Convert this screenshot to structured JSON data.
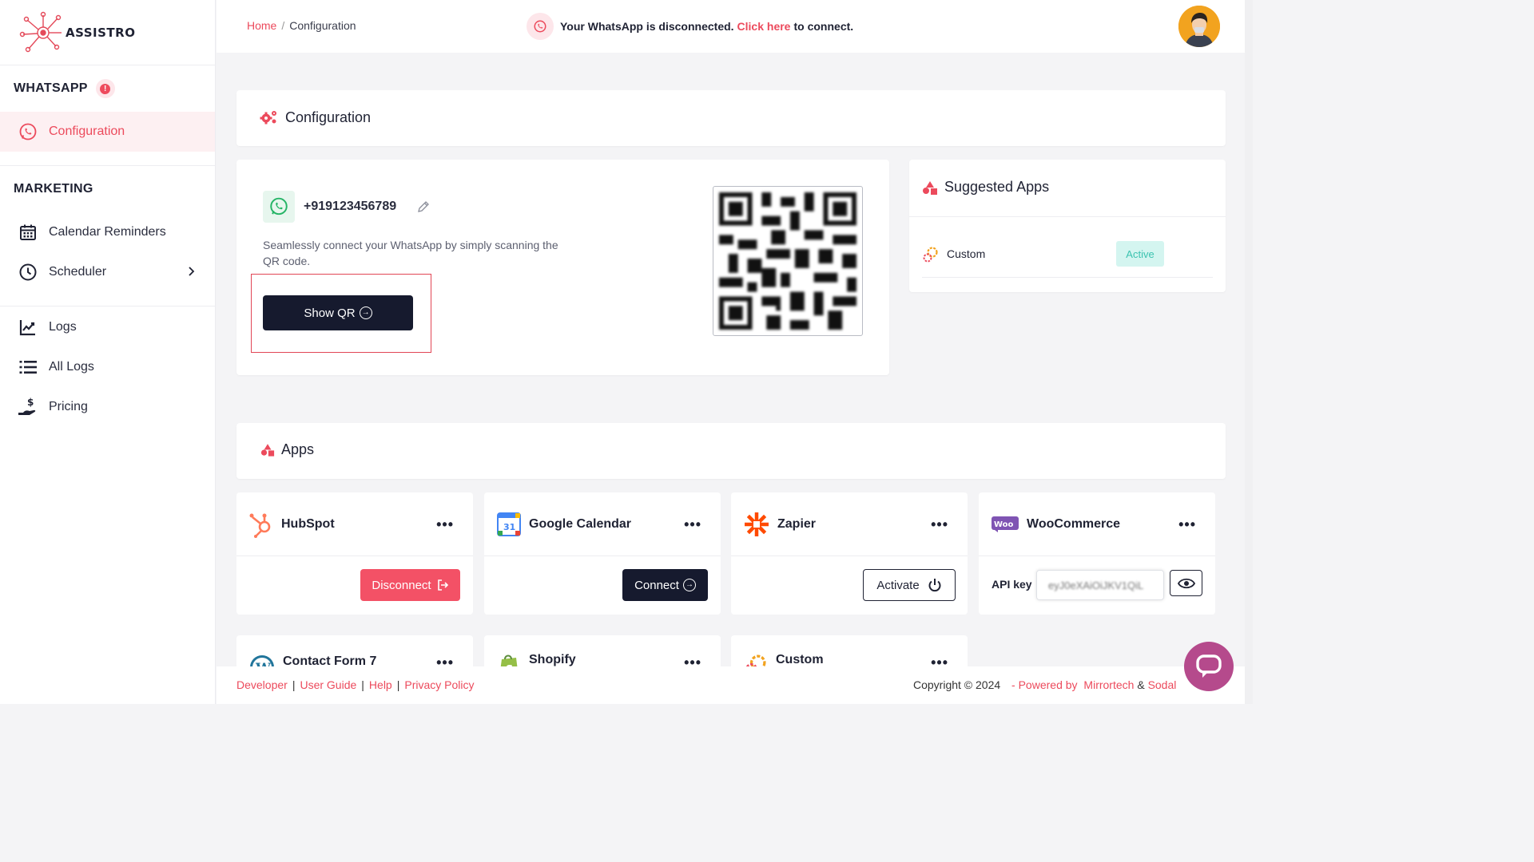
{
  "brand": {
    "name": "ASSISTRO"
  },
  "sidebar": {
    "whatsapp_title": "WHATSAPP",
    "whatsapp_alert": "!",
    "config_label": "Configuration",
    "marketing_title": "MARKETING",
    "calendar_label": "Calendar Reminders",
    "scheduler_label": "Scheduler",
    "logs_label": "Logs",
    "all_logs_label": "All Logs",
    "pricing_label": "Pricing"
  },
  "topbar": {
    "breadcrumb_home": "Home",
    "breadcrumb_sep": "/",
    "breadcrumb_current": "Configuration",
    "alert_prefix": "Your WhatsApp is disconnected.",
    "alert_link": "Click here",
    "alert_suffix": "to connect."
  },
  "config_header": {
    "title": "Configuration"
  },
  "whatsapp_card": {
    "phone": "+919123456789",
    "description": "Seamlessly connect your WhatsApp by simply scanning the QR code.",
    "show_qr_label": "Show QR"
  },
  "suggested": {
    "title": "Suggested Apps",
    "items": [
      {
        "name": "Custom",
        "status": "Active"
      }
    ]
  },
  "apps_header": {
    "title": "Apps"
  },
  "apps": {
    "hubspot": {
      "name": "HubSpot",
      "action": "Disconnect"
    },
    "gcal": {
      "name": "Google Calendar",
      "action": "Connect",
      "icon_text": "31"
    },
    "zapier": {
      "name": "Zapier",
      "action": "Activate"
    },
    "woo": {
      "name": "WooCommerce",
      "api_label": "API key",
      "api_value": "eyJ0eXAiOiJKV1QiL",
      "icon_text": "Woo"
    },
    "cf7": {
      "name": "Contact Form 7"
    },
    "shopify": {
      "name": "Shopify"
    },
    "custom": {
      "name": "Custom"
    },
    "menu_dots": "•••"
  },
  "footer": {
    "developer": "Developer",
    "user_guide": "User Guide",
    "help": "Help",
    "privacy": "Privacy Policy",
    "sep": "|",
    "copyright": "Copyright © 2024",
    "powered": "- Powered by",
    "mirrortech": "Mirrortech",
    "amp": "&",
    "sodal": "Sodal"
  },
  "colors": {
    "accent": "#ec4a5c",
    "dark": "#161a2e",
    "active_badge_bg": "#d4f5f0",
    "active_badge_text": "#3cc3b0"
  }
}
